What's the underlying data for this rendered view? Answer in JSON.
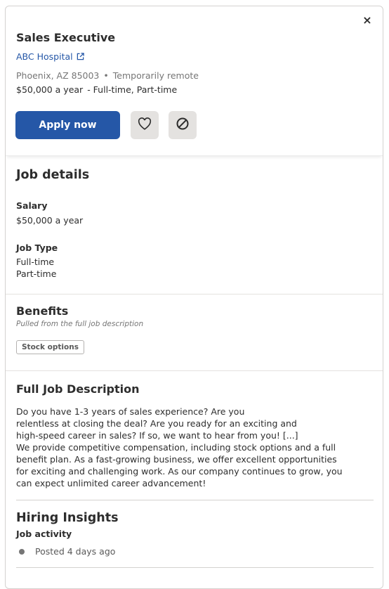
{
  "header": {
    "close_symbol": "×",
    "title": "Sales Executive",
    "company": "ABC Hospital",
    "location": "Phoenix, AZ 85003",
    "separator": "•",
    "remote": "Temporarily remote",
    "salary": "$50,000 a year",
    "job_types": "- Full-time, Part-time",
    "apply_label": "Apply now",
    "save_icon": "heart-icon",
    "not_interested_icon": "ban-icon"
  },
  "job_details": {
    "title": "Job details",
    "salary_label": "Salary",
    "salary_value": "$50,000 a year",
    "job_type_label": "Job Type",
    "job_types": [
      "Full-time",
      "Part-time"
    ]
  },
  "benefits": {
    "title": "Benefits",
    "note": "Pulled from the full job description",
    "tags": [
      "Stock options"
    ]
  },
  "description": {
    "title": "Full Job Description",
    "lines": [
      "Do you have 1-3 years of sales experience? Are you",
      "relentless at closing the deal? Are you ready for an exciting and",
      "high-speed career in sales? If so, we want to hear from you! [...]",
      "We provide competitive compensation, including stock options and a full",
      "benefit plan. As a fast-growing business, we offer excellent opportunities",
      "for exciting and challenging work. As our company continues to grow, you",
      "can expect unlimited career advancement!"
    ]
  },
  "insights": {
    "title": "Hiring Insights",
    "activity_label": "Job activity",
    "posted": "Posted 4 days ago"
  },
  "colors": {
    "accent": "#2557a7",
    "button_gray": "#e4e2e0",
    "text": "#2d2d2d",
    "muted": "#767676"
  }
}
